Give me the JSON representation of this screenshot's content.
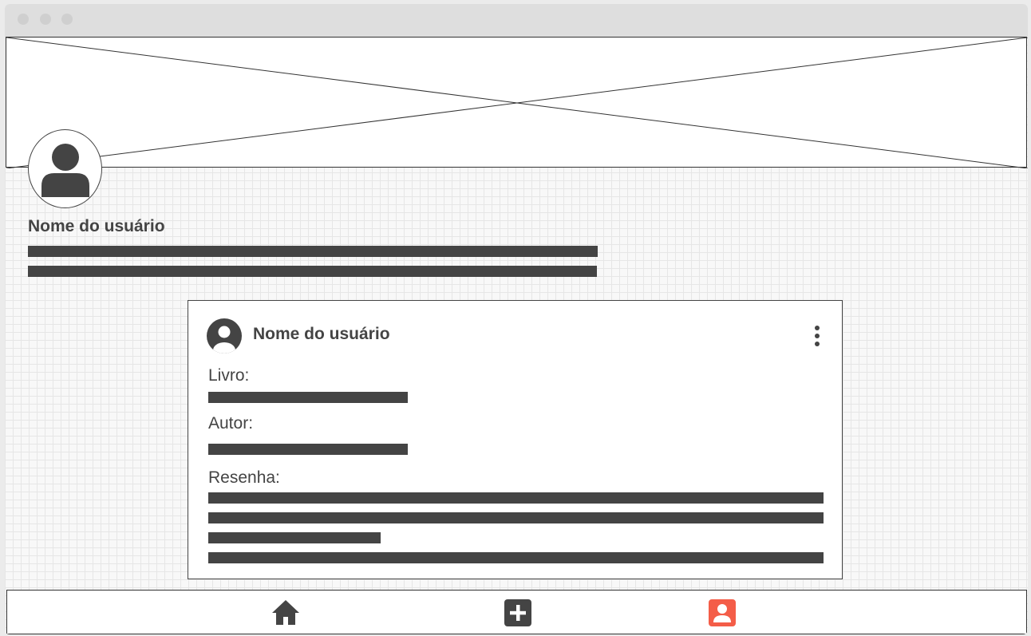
{
  "window": {
    "controls": [
      "close-dot",
      "minimize-dot",
      "maximize-dot"
    ]
  },
  "header": {
    "banner_image": "image-placeholder",
    "avatar_icon": "user-icon"
  },
  "profile": {
    "name": "Nome do usuário",
    "bio_placeholder_lines": 2
  },
  "post": {
    "avatar_icon": "user-circle-icon",
    "user_name": "Nome do usuário",
    "menu_icon": "more-vertical-icon",
    "fields": {
      "book_label": "Livro:",
      "author_label": "Autor:",
      "review_label": "Resenha:"
    }
  },
  "bottom_nav": {
    "items": [
      {
        "icon": "home-icon",
        "active": false
      },
      {
        "icon": "add-icon",
        "active": false
      },
      {
        "icon": "profile-icon",
        "active": true
      }
    ],
    "colors": {
      "default": "#444444",
      "active": "#f45d48"
    }
  }
}
